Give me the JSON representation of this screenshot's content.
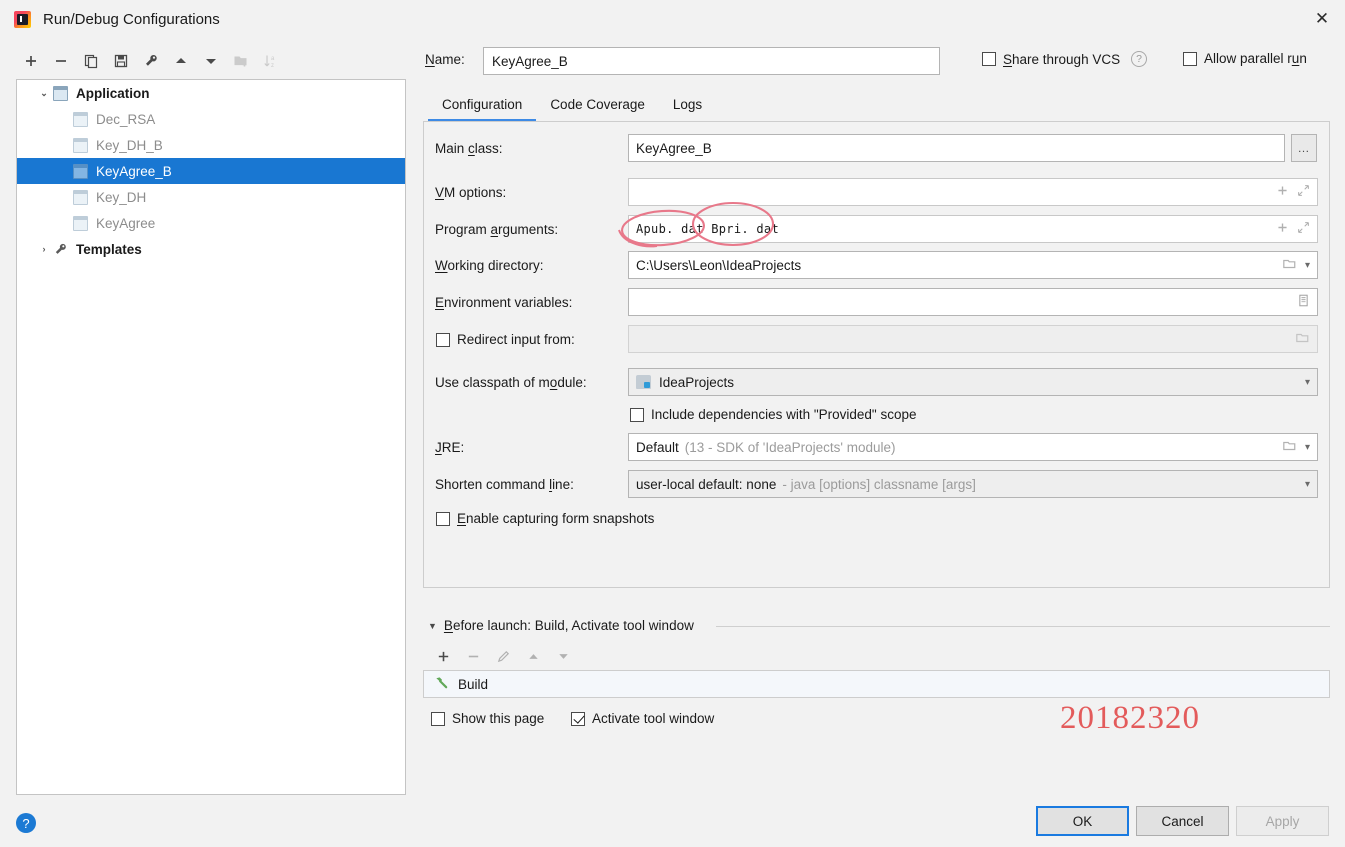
{
  "window": {
    "title": "Run/Debug Configurations",
    "app_icon": "intellij-idea-icon",
    "close_icon": "✕"
  },
  "left_toolbar": {
    "buttons": [
      {
        "name": "add-configuration-button",
        "icon": "plus-icon",
        "enabled": true
      },
      {
        "name": "remove-configuration-button",
        "icon": "minus-icon",
        "enabled": true
      },
      {
        "name": "copy-configuration-button",
        "icon": "copy-icon",
        "enabled": true
      },
      {
        "name": "save-configuration-button",
        "icon": "save-icon",
        "enabled": true
      },
      {
        "name": "edit-templates-button",
        "icon": "wrench-icon",
        "enabled": true
      },
      {
        "name": "move-up-button",
        "icon": "arrow-up-icon",
        "enabled": true
      },
      {
        "name": "move-down-button",
        "icon": "arrow-down-icon",
        "enabled": true
      },
      {
        "name": "new-folder-button",
        "icon": "folder-add-icon",
        "enabled": false
      },
      {
        "name": "sort-alphabetically-button",
        "icon": "sort-az-icon",
        "enabled": false
      }
    ]
  },
  "tree": {
    "root_label": "Application",
    "root_icon": "application-icon",
    "root_expander": "⌄",
    "items": [
      {
        "label": "Dec_RSA",
        "selected": false
      },
      {
        "label": "Key_DH_B",
        "selected": false
      },
      {
        "label": "KeyAgree_B",
        "selected": true
      },
      {
        "label": "Key_DH",
        "selected": false
      },
      {
        "label": "KeyAgree",
        "selected": false
      }
    ],
    "templates_label": "Templates",
    "templates_icon": "wrench-icon",
    "templates_expander": "›"
  },
  "header": {
    "name_label": "Name:",
    "name_mnemonic": "N",
    "name_value": "KeyAgree_B",
    "share_label": "Share through VCS",
    "share_mnemonic": "S",
    "share_checked": false,
    "share_help_icon": "question-mark-icon",
    "parallel_label": "Allow parallel run",
    "parallel_mnemonic": "u",
    "parallel_checked": false
  },
  "tabs": [
    {
      "label": "Configuration",
      "active": true
    },
    {
      "label": "Code Coverage",
      "active": false
    },
    {
      "label": "Logs",
      "active": false
    }
  ],
  "configuration": {
    "main_class": {
      "label_pre": "Main ",
      "label_mn": "c",
      "label_post": "lass:",
      "value": "KeyAgree_B",
      "browse_label": "…"
    },
    "vm_options": {
      "label_mn": "V",
      "label_post": "M options:",
      "value": "",
      "icons": [
        "plus-icon",
        "expand-icon"
      ]
    },
    "program_arguments": {
      "label_pre": "Program ",
      "label_mn": "a",
      "label_post": "rguments:",
      "value": "Apub. dat  Bpri. dat",
      "icons": [
        "plus-icon",
        "expand-icon"
      ]
    },
    "working_directory": {
      "label_mn": "W",
      "label_post": "orking directory:",
      "value": "C:\\Users\\Leon\\IdeaProjects",
      "icons": [
        "folder-icon",
        "chevron-down-icon"
      ]
    },
    "environment_variables": {
      "label_mn": "E",
      "label_post": "nvironment variables:",
      "value": "",
      "icons": [
        "edit-list-icon"
      ]
    },
    "redirect_input": {
      "label": "Redirect input from:",
      "checked": false,
      "value": "",
      "icons": [
        "folder-icon"
      ],
      "disabled": true
    },
    "classpath_module": {
      "label_pre": "Use classpath of m",
      "label_mn": "o",
      "label_post": "dule:",
      "value": "IdeaProjects",
      "value_icon": "module-icon",
      "icons": [
        "chevron-down-icon"
      ]
    },
    "include_provided": {
      "label": "Include dependencies with \"Provided\" scope",
      "checked": false
    },
    "jre": {
      "label_mn": "J",
      "label_post": "RE:",
      "value": "Default",
      "hint": "(13 - SDK of 'IdeaProjects' module)",
      "icons": [
        "folder-icon",
        "chevron-down-icon"
      ]
    },
    "shorten_command_line": {
      "label_pre": "Shorten command ",
      "label_mn": "l",
      "label_post": "ine:",
      "value": "user-local default: none",
      "hint": "- java [options] classname [args]",
      "icons": [
        "chevron-down-icon"
      ]
    },
    "form_snapshots": {
      "label_mn": "E",
      "label_post": "nable capturing form snapshots",
      "checked": false
    }
  },
  "before_launch": {
    "triangle": "▼",
    "title_mn": "B",
    "title_post": "efore launch: Build, Activate tool window",
    "toolbar": [
      {
        "name": "add-task-button",
        "icon": "plus-icon",
        "enabled": true
      },
      {
        "name": "remove-task-button",
        "icon": "minus-icon",
        "enabled": false
      },
      {
        "name": "edit-task-button",
        "icon": "pencil-icon",
        "enabled": false
      },
      {
        "name": "move-task-up-button",
        "icon": "arrow-up-icon",
        "enabled": false
      },
      {
        "name": "move-task-down-button",
        "icon": "arrow-down-icon",
        "enabled": false
      }
    ],
    "tasks": [
      {
        "label": "Build",
        "icon": "build-hammer-icon"
      }
    ],
    "show_this_page_label": "Show this page",
    "show_this_page_checked": false,
    "activate_tool_window_label": "Activate tool window",
    "activate_tool_window_checked": true
  },
  "annotation": {
    "watermark_text": "20182320",
    "watermark_color": "#e35b5b",
    "ink_color": "#e8788a"
  },
  "footer": {
    "help_icon": "question-mark-icon",
    "ok_label": "OK",
    "cancel_label": "Cancel",
    "apply_label": "Apply",
    "apply_enabled": false
  }
}
